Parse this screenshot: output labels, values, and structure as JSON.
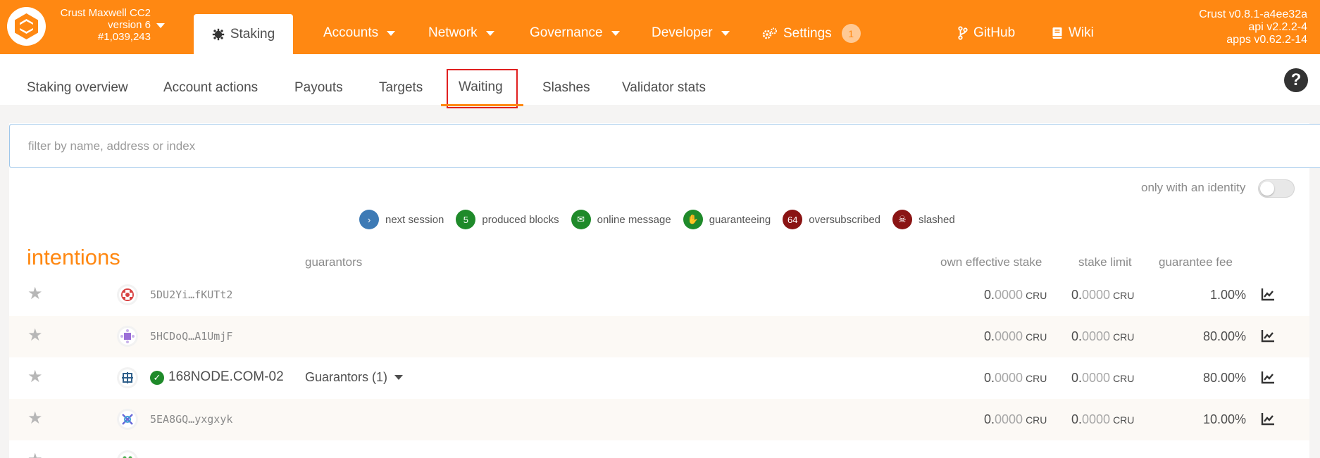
{
  "chain": {
    "name": "Crust Maxwell CC2",
    "version": "version 6",
    "block": "#1,039,243"
  },
  "nav": {
    "staking": "Staking",
    "accounts": "Accounts",
    "network": "Network",
    "governance": "Governance",
    "developer": "Developer",
    "settings": "Settings",
    "settings_badge": "1",
    "github": "GitHub",
    "wiki": "Wiki"
  },
  "versions": {
    "crust": "Crust v0.8.1-a4ee32a",
    "api": "api v2.2.2-4",
    "apps": "apps v0.62.2-14"
  },
  "subtabs": [
    "Staking overview",
    "Account actions",
    "Payouts",
    "Targets",
    "Waiting",
    "Slashes",
    "Validator stats"
  ],
  "active_subtab": "Waiting",
  "filter": {
    "placeholder": "filter by name, address or index"
  },
  "identity_toggle": {
    "label": "only with an identity",
    "on": false
  },
  "legend": [
    {
      "label": "next session",
      "badge": "›",
      "color": "#3d7ab5"
    },
    {
      "label": "produced blocks",
      "badge": "5",
      "color": "#1f8a2a"
    },
    {
      "label": "online message",
      "badge": "✉",
      "color": "#1f8a2a"
    },
    {
      "label": "guaranteeing",
      "badge": "✋",
      "color": "#1f8a2a"
    },
    {
      "label": "oversubscribed",
      "badge": "64",
      "color": "#8a1414"
    },
    {
      "label": "slashed",
      "badge": "☠",
      "color": "#8a1414"
    }
  ],
  "table": {
    "title": "intentions",
    "headers": {
      "guarantors": "guarantors",
      "own_stake": "own effective stake",
      "stake_limit": "stake limit",
      "fee": "guarantee fee"
    },
    "rows": [
      {
        "address": "5DU2Yi…fKUTt2",
        "named": false,
        "guarantors": "",
        "own_int": "0.",
        "own_frac": "0000",
        "own_unit": "CRU",
        "limit_int": "0.",
        "limit_frac": "0000",
        "limit_unit": "CRU",
        "fee": "1.00%"
      },
      {
        "address": "5HCDoQ…A1UmjF",
        "named": false,
        "guarantors": "",
        "own_int": "0.",
        "own_frac": "0000",
        "own_unit": "CRU",
        "limit_int": "0.",
        "limit_frac": "0000",
        "limit_unit": "CRU",
        "fee": "80.00%"
      },
      {
        "address": "168NODE.COM-02",
        "named": true,
        "guarantors": "Guarantors (1)",
        "own_int": "0.",
        "own_frac": "0000",
        "own_unit": "CRU",
        "limit_int": "0.",
        "limit_frac": "0000",
        "limit_unit": "CRU",
        "fee": "80.00%"
      },
      {
        "address": "5EA8GQ…yxgxyk",
        "named": false,
        "guarantors": "",
        "own_int": "0.",
        "own_frac": "0000",
        "own_unit": "CRU",
        "limit_int": "0.",
        "limit_frac": "0000",
        "limit_unit": "CRU",
        "fee": "10.00%"
      }
    ]
  },
  "colors": {
    "brand": "#ff8812",
    "highlight_box": "#e02020"
  }
}
